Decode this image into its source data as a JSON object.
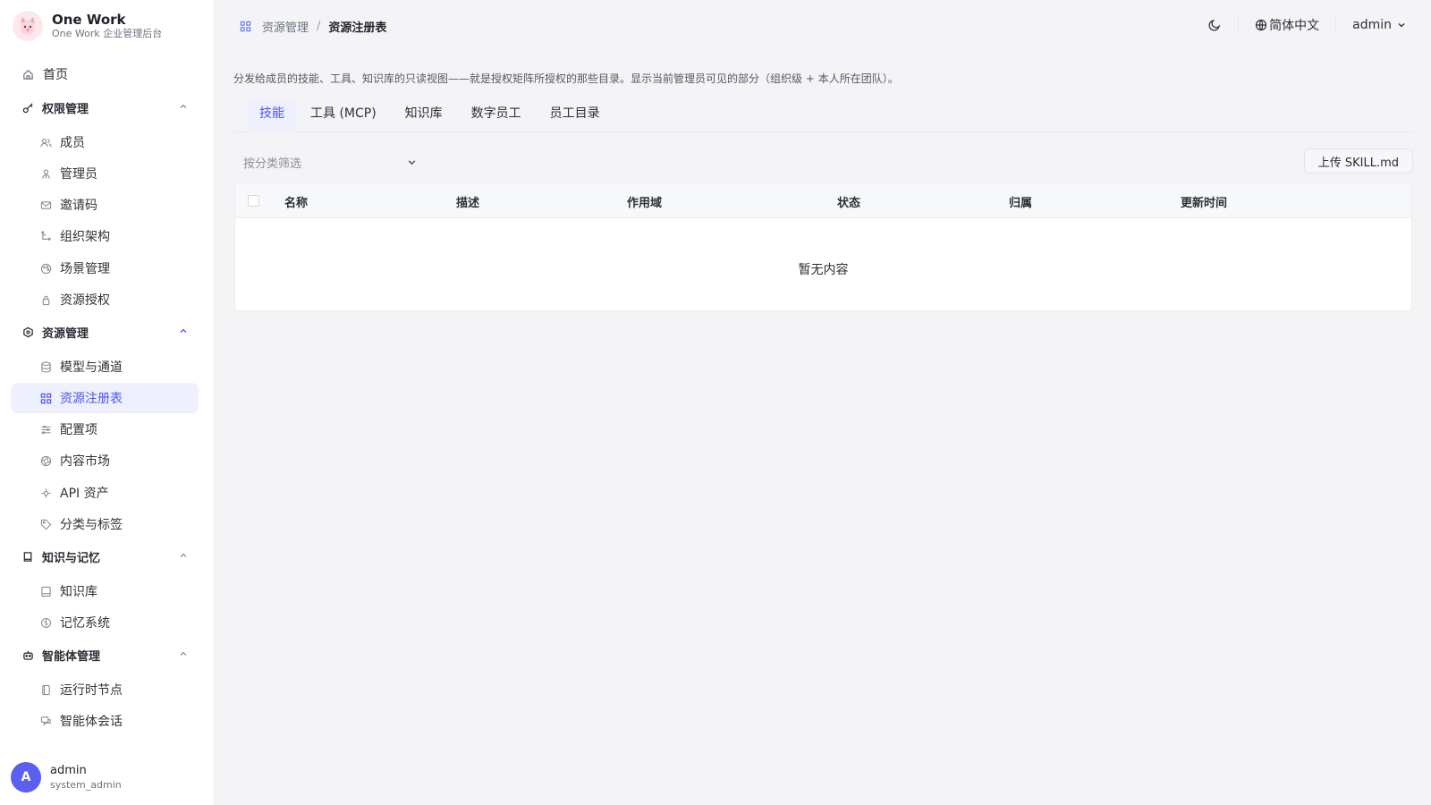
{
  "brand": {
    "name": "One Work",
    "subtitle": "One Work 企业管理后台"
  },
  "sidebar": {
    "home": "首页",
    "groups": [
      {
        "label": "权限管理",
        "items": [
          "成员",
          "管理员",
          "邀请码",
          "组织架构",
          "场景管理",
          "资源授权"
        ]
      },
      {
        "label": "资源管理",
        "items": [
          "模型与通道",
          "资源注册表",
          "配置项",
          "内容市场",
          "API 资产",
          "分类与标签"
        ]
      },
      {
        "label": "知识与记忆",
        "items": [
          "知识库",
          "记忆系统"
        ]
      },
      {
        "label": "智能体管理",
        "items": [
          "运行时节点",
          "智能体会话"
        ]
      }
    ],
    "active_item": "资源注册表"
  },
  "user": {
    "initial": "A",
    "name": "admin",
    "role": "system_admin"
  },
  "breadcrumb": {
    "parent": "资源管理",
    "separator": "/",
    "current": "资源注册表"
  },
  "header": {
    "language": "简体中文",
    "account": "admin"
  },
  "description": "分发给成员的技能、工具、知识库的只读视图——就是授权矩阵所授权的那些目录。显示当前管理员可见的部分（组织级 + 本人所在团队）。",
  "tabs": [
    "技能",
    "工具 (MCP)",
    "知识库",
    "数字员工",
    "员工目录"
  ],
  "active_tab": "技能",
  "filter": {
    "placeholder": "按分类筛选"
  },
  "upload_button": "上传 SKILL.md",
  "table": {
    "columns": [
      "名称",
      "描述",
      "作用域",
      "状态",
      "归属",
      "更新时间"
    ],
    "rows": [],
    "empty_text": "暂无内容"
  },
  "colors": {
    "accent": "#4f54e6",
    "active_bg": "#eef0fd",
    "avatar": "#5b5ff0"
  }
}
